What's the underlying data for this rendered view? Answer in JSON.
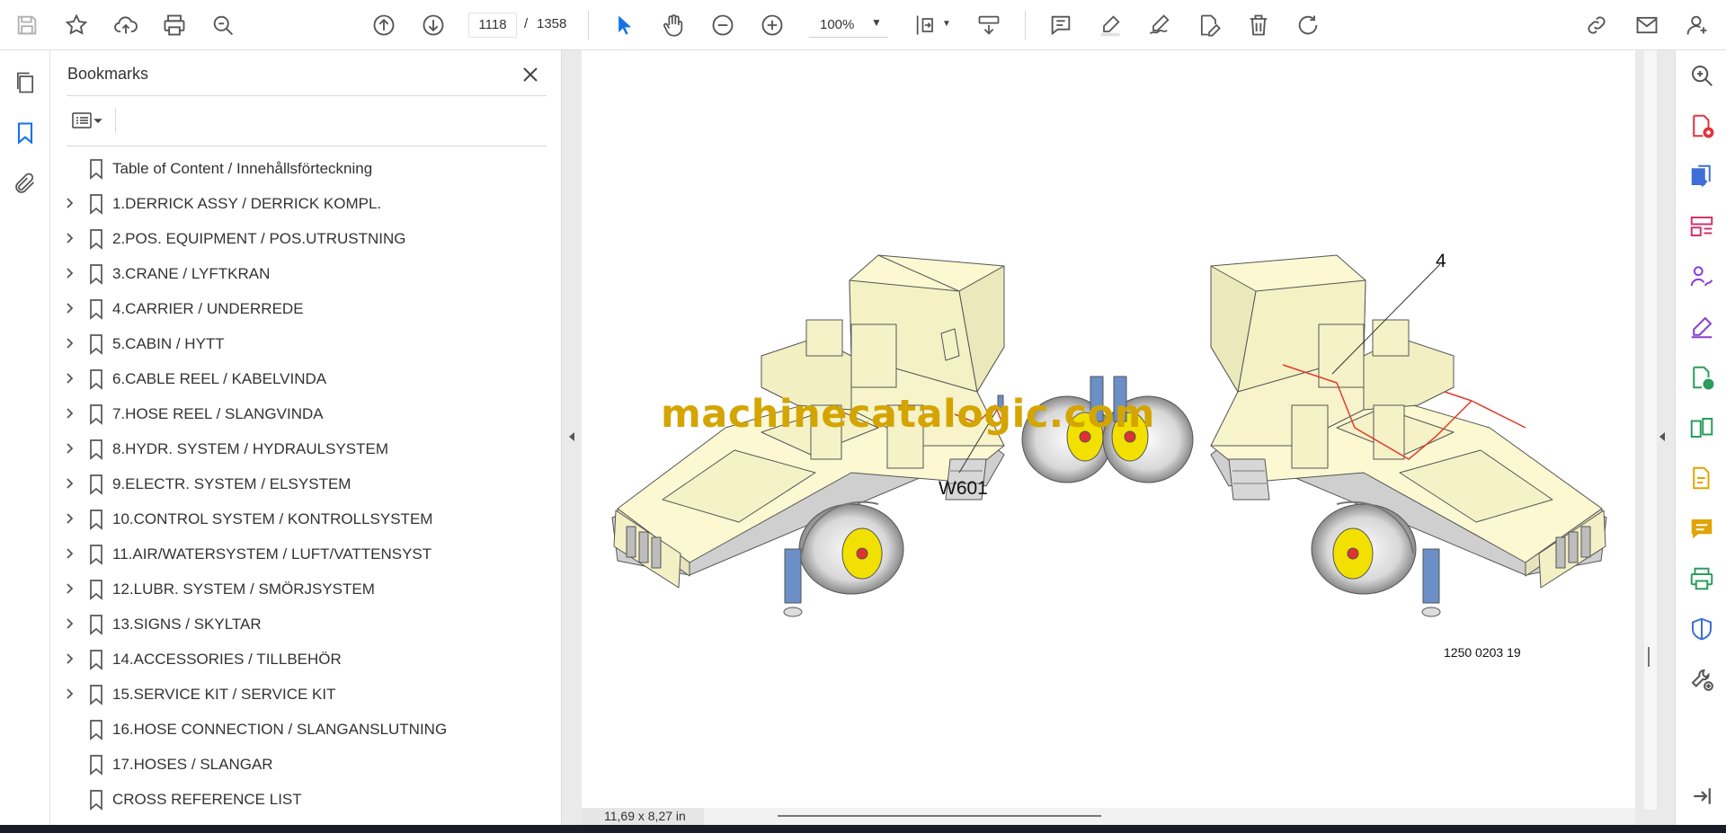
{
  "toolbar": {
    "page_current": "1118",
    "page_separator": "/",
    "page_total": "1358",
    "zoom": "100%",
    "icons": [
      "save-icon",
      "star-icon",
      "upload-cloud-icon",
      "print-icon",
      "zoom-search-icon",
      "page-up-icon",
      "page-down-icon",
      "select-arrow-icon",
      "hand-icon",
      "zoom-out-icon",
      "zoom-in-icon",
      "fit-page-icon",
      "scroll-mode-icon",
      "comment-icon",
      "highlight-pen-icon",
      "draw-icon",
      "edit-text-icon",
      "delete-icon",
      "rotate-icon",
      "share-link-icon",
      "email-icon",
      "account-icon"
    ]
  },
  "left_rail": {
    "icons": [
      "pages-icon",
      "bookmark-icon",
      "attachment-icon"
    ]
  },
  "bookmarks": {
    "title": "Bookmarks",
    "items": [
      {
        "label": "Table of Content / Innehållsförteckning",
        "expandable": false
      },
      {
        "label": "1.DERRICK ASSY / DERRICK KOMPL.",
        "expandable": true
      },
      {
        "label": "2.POS. EQUIPMENT / POS.UTRUSTNING",
        "expandable": true
      },
      {
        "label": "3.CRANE / LYFTKRAN",
        "expandable": true
      },
      {
        "label": "4.CARRIER / UNDERREDE",
        "expandable": true
      },
      {
        "label": "5.CABIN / HYTT",
        "expandable": true
      },
      {
        "label": "6.CABLE REEL / KABELVINDA",
        "expandable": true
      },
      {
        "label": "7.HOSE REEL / SLANGVINDA",
        "expandable": true
      },
      {
        "label": "8.HYDR. SYSTEM / HYDRAULSYSTEM",
        "expandable": true
      },
      {
        "label": "9.ELECTR. SYSTEM / ELSYSTEM",
        "expandable": true
      },
      {
        "label": "10.CONTROL SYSTEM / KONTROLLSYSTEM",
        "expandable": true
      },
      {
        "label": "11.AIR/WATERSYSTEM / LUFT/VATTENSYST",
        "expandable": true
      },
      {
        "label": "12.LUBR. SYSTEM / SMÖRJSYSTEM",
        "expandable": true
      },
      {
        "label": "13.SIGNS / SKYLTAR",
        "expandable": true
      },
      {
        "label": "14.ACCESSORIES / TILLBEHÖR",
        "expandable": true
      },
      {
        "label": "15.SERVICE KIT / SERVICE KIT",
        "expandable": true
      },
      {
        "label": "16.HOSE CONNECTION / SLANGANSLUTNING",
        "expandable": false
      },
      {
        "label": "17.HOSES / SLANGAR",
        "expandable": false
      },
      {
        "label": "CROSS REFERENCE LIST",
        "expandable": false
      }
    ]
  },
  "document": {
    "watermark": "machinecatalogic.com",
    "callout_left": "W601",
    "callout_right": "4",
    "drawing_number": "1250 0203 19",
    "page_size": "11,69 x 8,27 in"
  },
  "right_rail": {
    "icons": [
      "zoom-tool-icon",
      "create-pdf-icon",
      "export-pdf-icon",
      "organize-pages-icon",
      "request-signature-icon",
      "fill-sign-icon",
      "send-for-review-icon",
      "compare-icon",
      "edit-pdf-icon",
      "comment-tool-icon",
      "print-production-icon",
      "protect-icon",
      "more-tools-icon",
      "collapse-pane-icon"
    ]
  },
  "colors": {
    "accent_blue": "#1473e6",
    "machine_body": "#fbf8d2",
    "wheel_yellow": "#f2e000",
    "watermark": "#d4a500",
    "cable_red": "#e23b2b"
  }
}
